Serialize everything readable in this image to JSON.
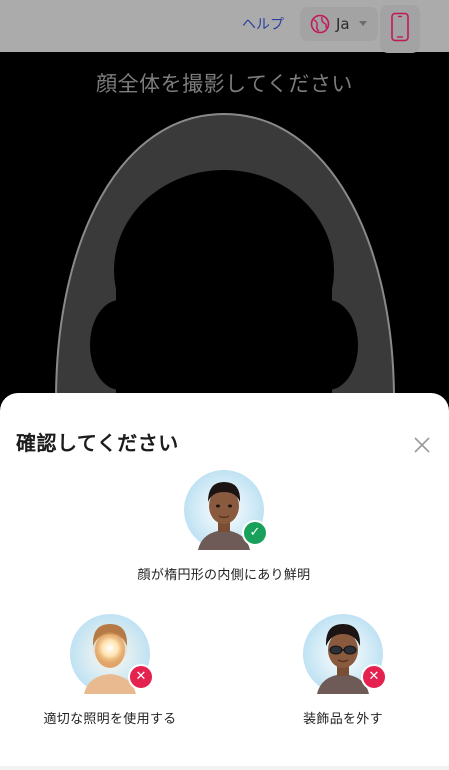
{
  "header": {
    "help_label": "ヘルプ",
    "language_label": "Ja",
    "language_icon": "globe-icon",
    "device_icon": "smartphone-icon"
  },
  "camera": {
    "instruction": "顔全体を撮影してください"
  },
  "sheet": {
    "title": "確認してください",
    "close_icon": "close-icon",
    "examples": [
      {
        "caption": "顔が楕円形の内側にあり鮮明",
        "status": "correct",
        "badge_icon": "check-icon"
      },
      {
        "caption": "適切な照明を使用する",
        "status": "incorrect",
        "badge_icon": "cross-icon"
      },
      {
        "caption": "装飾品を外す",
        "status": "incorrect",
        "badge_icon": "cross-icon"
      }
    ]
  },
  "colors": {
    "accent": "#2a3fa0",
    "ok": "#19a05a",
    "error": "#e4214f",
    "phone_icon": "#c2185b"
  }
}
